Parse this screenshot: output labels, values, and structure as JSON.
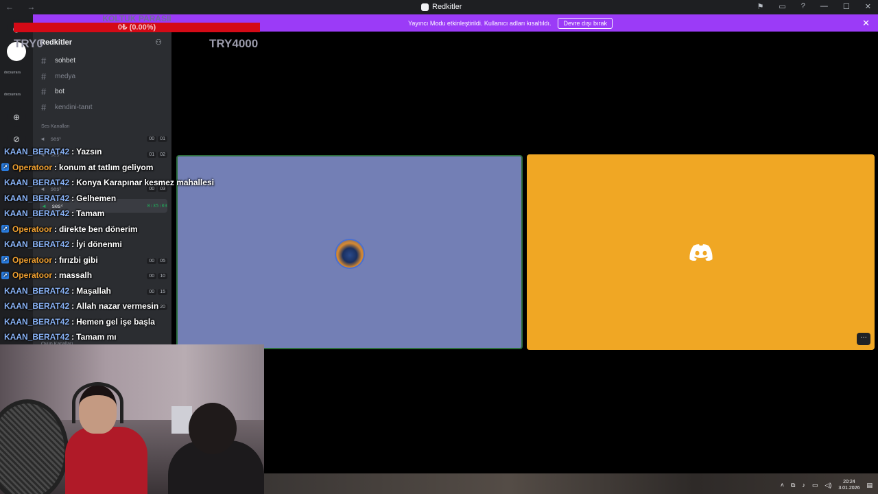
{
  "window": {
    "title": "Redkitler",
    "nav": "← →"
  },
  "banner": {
    "message": "Yayıncı Modu etkinleştirildi. Kullanıcı adları kısaltıldı.",
    "button": "Devre dışı bırak"
  },
  "sidebar": {
    "server_name": "Redkitler",
    "rail_labels": [
      "docsurrara",
      "docsurrara"
    ],
    "text_channels": [
      {
        "name": "sohbet"
      },
      {
        "name": "medya"
      },
      {
        "name": "bot"
      },
      {
        "name": "kendini-tanıt"
      }
    ],
    "voice_category": "Ses Kanalları",
    "voice_channels": [
      {
        "name": "ses¹",
        "badge": [
          "00",
          "01"
        ]
      },
      {
        "name": "ses²",
        "badge": [
          "01",
          "02"
        ]
      },
      {
        "name": "ses³",
        "badge": [
          "00",
          "03"
        ]
      },
      {
        "name": "ses⁴",
        "timer": "8:35:03"
      }
    ],
    "other_badges": [
      [
        "00",
        "05"
      ],
      [
        "00",
        "10"
      ],
      [
        "00",
        "15"
      ],
      [
        "00",
        "20"
      ]
    ],
    "bottom_category": "Oyun Kanalları"
  },
  "overlay": {
    "title": "KOLTUK PARASII",
    "progress": "0₺ (0.00%)",
    "try_left": "TRY0",
    "try_right": "TRY4000"
  },
  "chat": [
    {
      "user": "KAAN_BERAT42",
      "type": "kaan",
      "text": "Yazsın"
    },
    {
      "user": "Operatoor",
      "type": "op",
      "text": "konum at tatlım geliyom"
    },
    {
      "user": "KAAN_BERAT42",
      "type": "kaan",
      "text": "Konya Karapınar kesmez mahallesi"
    },
    {
      "user": "KAAN_BERAT42",
      "type": "kaan",
      "text": "Gelhemen"
    },
    {
      "user": "KAAN_BERAT42",
      "type": "kaan",
      "text": "Tamam"
    },
    {
      "user": "Operatoor",
      "type": "op",
      "text": "direkte ben dönerim"
    },
    {
      "user": "KAAN_BERAT42",
      "type": "kaan",
      "text": "İyi dönenmi"
    },
    {
      "user": "Operatoor",
      "type": "op",
      "text": "fırızbi gibi"
    },
    {
      "user": "Operatoor",
      "type": "op",
      "text": "massalh"
    },
    {
      "user": "KAAN_BERAT42",
      "type": "kaan",
      "text": "Maşallah"
    },
    {
      "user": "KAAN_BERAT42",
      "type": "kaan",
      "text": "Allah nazar vermesin"
    },
    {
      "user": "KAAN_BERAT42",
      "type": "kaan",
      "text": "Hemen gel işe başla"
    },
    {
      "user": "KAAN_BERAT42",
      "type": "kaan",
      "text": "Tamam mı"
    }
  ],
  "tiles": {
    "more": "···"
  },
  "clock": {
    "time": "20:24",
    "date": "3.01.2026"
  },
  "colors": {
    "banner": "#9b3bf7",
    "tile1": "#737fb5",
    "tile2": "#f0a724",
    "kaan": "#8ab4f8",
    "operatoor": "#f0a030"
  }
}
